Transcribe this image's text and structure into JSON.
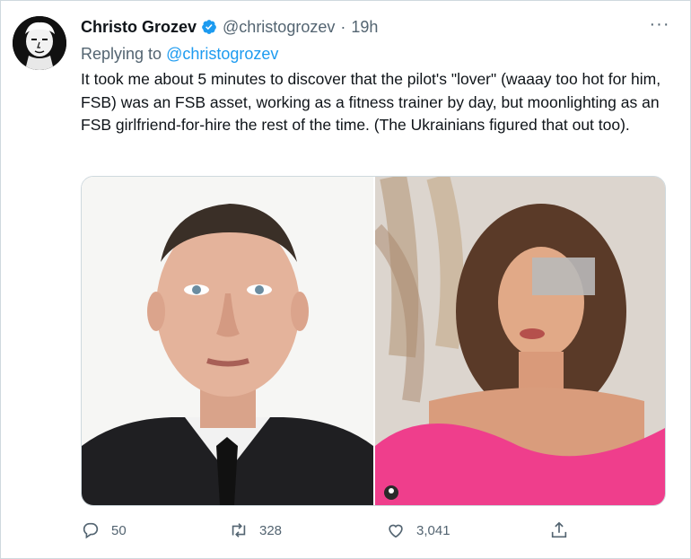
{
  "tweet": {
    "author_name": "Christo Grozev",
    "handle": "@christogrozev",
    "separator": "·",
    "time": "19h",
    "more_label": "···",
    "replying_prefix": "Replying to",
    "replying_handle": "@christogrozev",
    "text": "It took me about 5 minutes to discover that the pilot's \"lover\" (waaay too hot for him, FSB) was an FSB asset, working as a fitness trainer by day, but moonlighting as an FSB girlfriend-for-hire the rest of the time. (The Ukrainians figured that out too)."
  },
  "icons": {
    "verified": "verified-badge-icon",
    "reply": "reply-icon",
    "retweet": "retweet-icon",
    "like": "heart-icon",
    "share": "share-icon"
  },
  "actions": {
    "replies": "50",
    "retweets": "328",
    "likes": "3,041"
  },
  "colors": {
    "accent": "#1d9bf0",
    "secondary_text": "#536471"
  }
}
